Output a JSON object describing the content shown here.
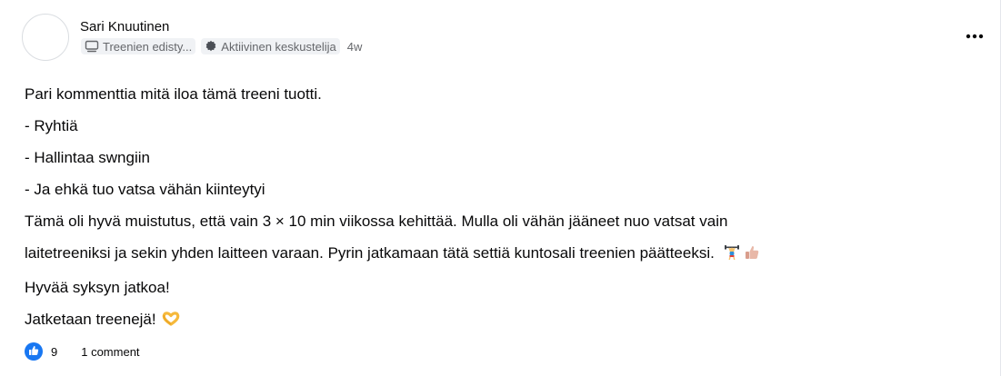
{
  "post": {
    "author": "Sari Knuutinen",
    "group_chip": "Treenien edisty...",
    "badge_chip": "Aktiivinen keskustelija",
    "time": "4w",
    "body": {
      "line1": "Pari kommenttia mitä iloa tämä treeni tuotti.",
      "line2": "- Ryhtiä",
      "line3": "- Hallintaa swngiin",
      "line4": "- Ja ehkä tuo vatsa vähän kiinteytyi",
      "line5": "Tämä oli hyvä muistutus, että vain 3 × 10 min viikossa kehittää. Mulla oli vähän jääneet nuo vatsat vain",
      "line6": "laitetreeniksi ja sekin yhden laitteen varaan. Pyrin jatkamaan tätä settiä kuntosali treenien päätteeksi.",
      "line7": "Hyvää syksyn jatkoa!",
      "line8": "Jatketaan treenejä!"
    },
    "reactions": {
      "like_count": "9",
      "comments": "1 comment"
    }
  },
  "colors": {
    "like_blue": "#1877f2",
    "secondary_text": "#65676b",
    "chip_bg": "#f0f2f5"
  },
  "icons": [
    "group-icon",
    "badge-icon",
    "more-options-icon",
    "weightlifter-emoji",
    "thumbs-up-emoji",
    "heart-hands-emoji",
    "like-icon"
  ]
}
